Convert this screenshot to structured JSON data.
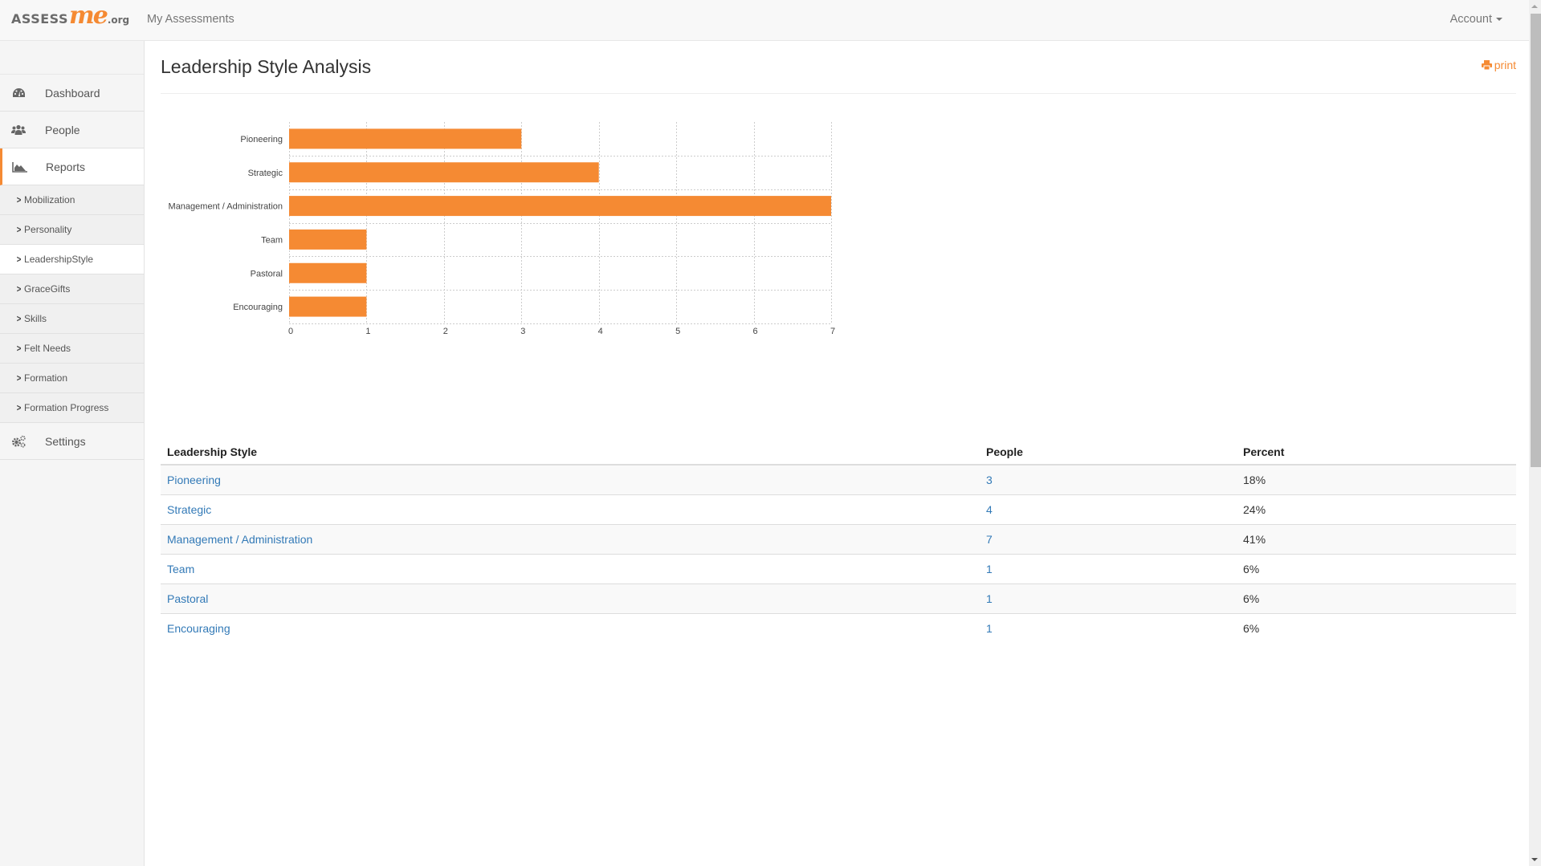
{
  "navbar": {
    "brand": {
      "part1": "ASSESS",
      "part2": "me",
      "part3": ".org"
    },
    "my_assessments": "My Assessments",
    "account": "Account"
  },
  "sidebar": {
    "items": [
      {
        "label": "Dashboard",
        "icon": "dashboard-icon"
      },
      {
        "label": "People",
        "icon": "users-icon"
      },
      {
        "label": "Reports",
        "icon": "area-chart-icon",
        "active": true
      }
    ],
    "subitems": [
      {
        "label": "Mobilization"
      },
      {
        "label": "Personality"
      },
      {
        "label": "LeadershipStyle",
        "active": true
      },
      {
        "label": "GraceGifts"
      },
      {
        "label": "Skills"
      },
      {
        "label": "Felt Needs"
      },
      {
        "label": "Formation"
      },
      {
        "label": "Formation Progress"
      }
    ],
    "settings": {
      "label": "Settings",
      "icon": "cogs-icon"
    }
  },
  "main": {
    "title": "Leadership Style Analysis",
    "print_label": "print",
    "accent_color": "#f58a33"
  },
  "chart_data": {
    "type": "bar",
    "orientation": "horizontal",
    "categories": [
      "Pioneering",
      "Strategic",
      "Management / Administration",
      "Team",
      "Pastoral",
      "Encouraging"
    ],
    "values": [
      3,
      4,
      7,
      1,
      1,
      1
    ],
    "xticks": [
      "0",
      "1",
      "2",
      "3",
      "4",
      "5",
      "6",
      "7"
    ],
    "xlim": [
      0,
      7
    ],
    "grid": true,
    "bar_color": "#f58a33",
    "title": "",
    "xlabel": "",
    "ylabel": ""
  },
  "table": {
    "headers": [
      "Leadership Style",
      "People",
      "Percent"
    ],
    "rows": [
      {
        "style": "Pioneering",
        "people": "3",
        "percent": "18%"
      },
      {
        "style": "Strategic",
        "people": "4",
        "percent": "24%"
      },
      {
        "style": "Management / Administration",
        "people": "7",
        "percent": "41%"
      },
      {
        "style": "Team",
        "people": "1",
        "percent": "6%"
      },
      {
        "style": "Pastoral",
        "people": "1",
        "percent": "6%"
      },
      {
        "style": "Encouraging",
        "people": "1",
        "percent": "6%"
      }
    ]
  }
}
